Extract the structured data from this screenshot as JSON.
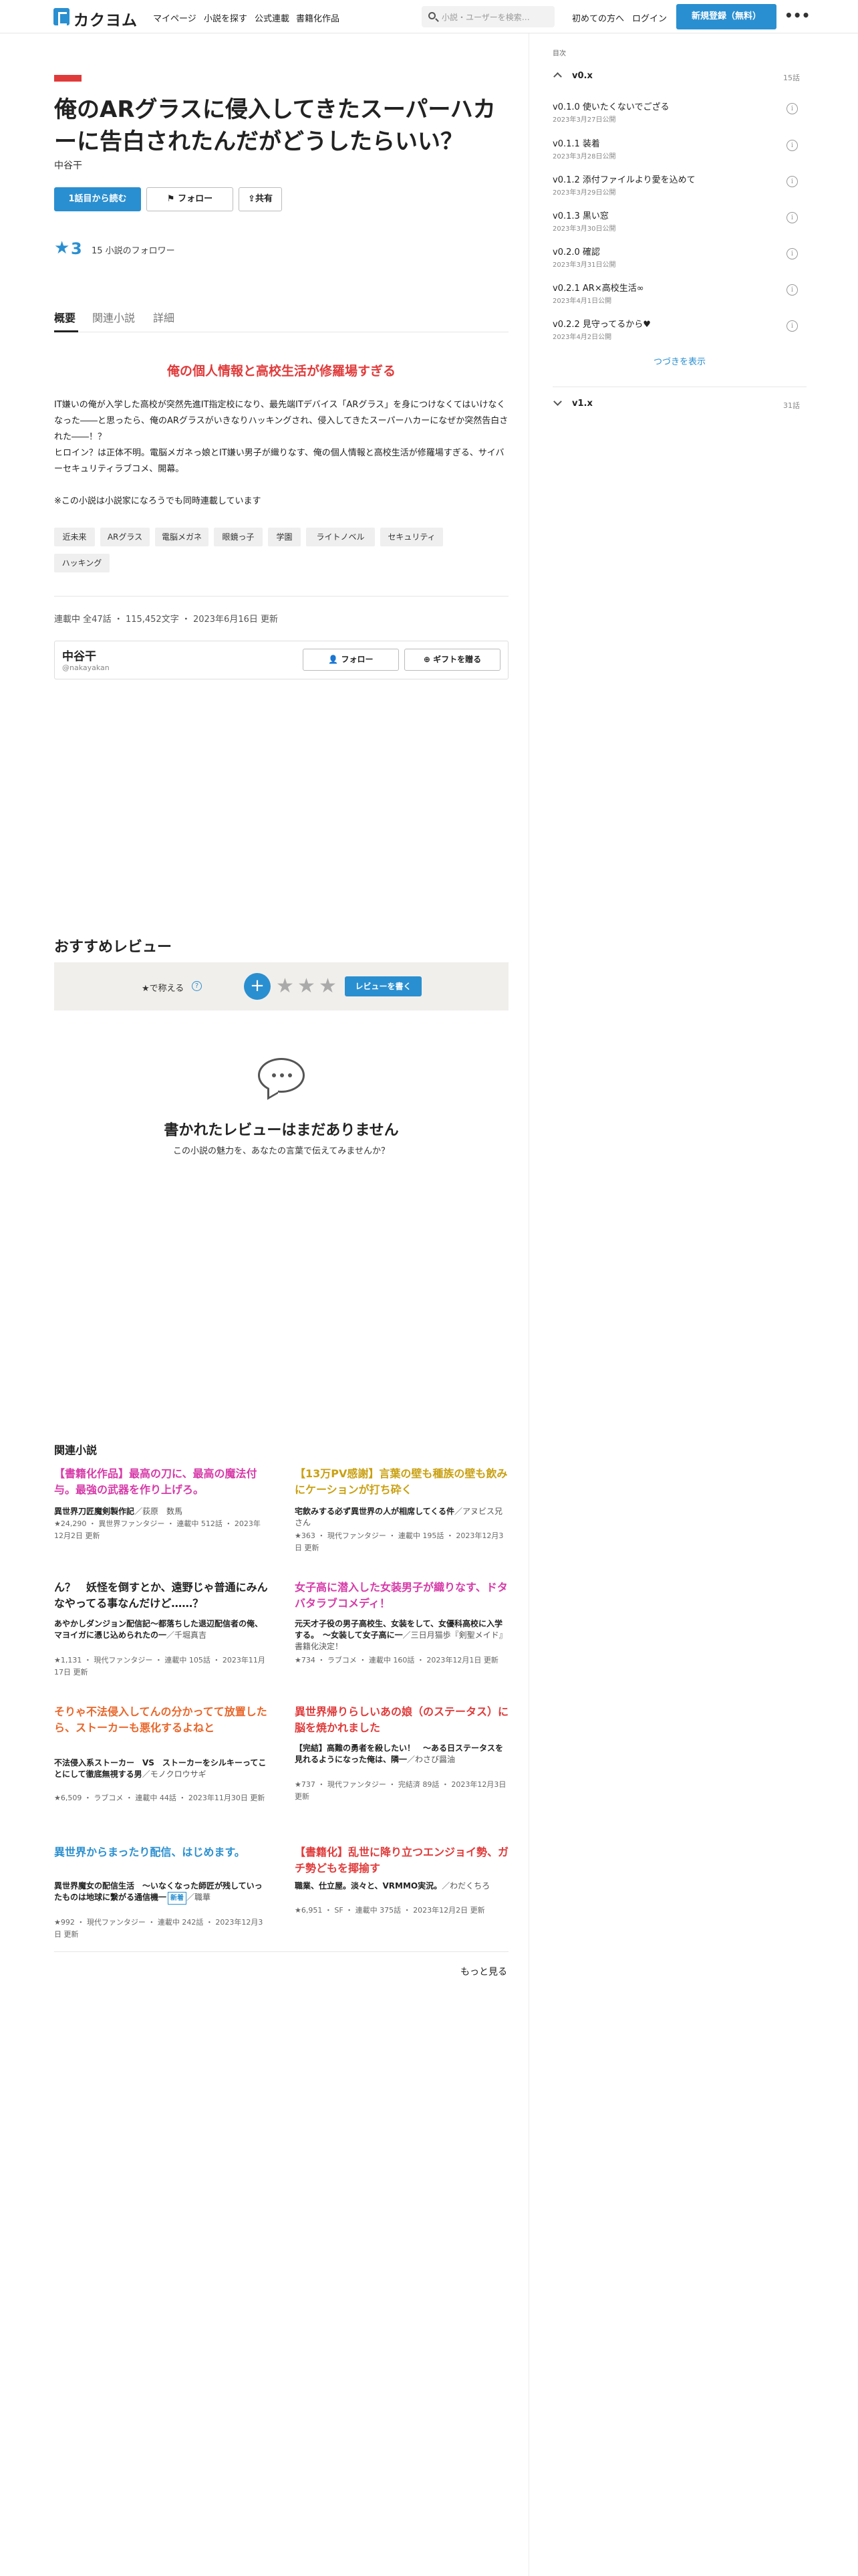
{
  "header": {
    "logo": "カクヨム",
    "nav": [
      "マイページ",
      "小説を探す",
      "公式連載",
      "書籍化作品"
    ],
    "search_placeholder": "小説・ユーザーを検索…",
    "first_time": "初めての方へ",
    "login": "ログイン",
    "register": "新規登録（無料）",
    "more": "•••"
  },
  "work": {
    "title": "俺のARグラスに侵入してきたスーパーハカーに告白されたんだがどうしたらいい？",
    "author": "中谷干",
    "read_button": "1話目から読む",
    "follow_button": "フォロー",
    "share_button": "共有",
    "stars": "3",
    "followers": "15 小説のフォロワー",
    "tabs": [
      "概要",
      "関連小説",
      "詳細"
    ],
    "catchphrase": "俺の個人情報と高校生活が修羅場すぎる",
    "introduction": "IT嫌いの俺が入学した高校が突然先進IT指定校になり、最先端ITデバイス「ARグラス」を身につけなくてはいけなくなった――と思ったら、俺のARグラスがいきなりハッキングされ、侵入してきたスーパーハカーになぜか突然告白された――！？\nヒロイン？は正体不明。電脳メガネっ娘とIT嫌い男子が織りなす、俺の個人情報と高校生活が修羅場すぎる、サイバーセキュリティラブコメ、開幕。\n\n※この小説は小説家になろうでも同時連載しています",
    "tags": [
      "近未来",
      "ARグラス",
      "電脳メガネ",
      "眼鏡っ子",
      "学園",
      "ライトノベル",
      "セキュリティ",
      "ハッキング"
    ],
    "meta": "連載中 全47話 ・ 115,452文字 ・ 2023年6月16日 更新"
  },
  "author_card": {
    "name": "中谷干",
    "id": "@nakayakan",
    "follow": "フォロー",
    "gift": "ギフトを贈る"
  },
  "reviews": {
    "heading": "おすすめレビュー",
    "star_label": "★で称える",
    "help": "?",
    "plus": "+",
    "write_button": "レビューを書く",
    "empty_title": "書かれたレビューはまだありません",
    "empty_sub": "この小説の魅力を、あなたの言葉で伝えてみませんか？"
  },
  "related": {
    "heading": "関連小説",
    "more": "もっと見る",
    "items": [
      {
        "title": "【書籍化作品】最高の刀に、最高の魔法付与。最強の武器を作り上げろ。",
        "catch": "異世界刀匠魔剣製作記",
        "author": "／荻原　数馬",
        "meta": "★24,290 ・ 異世界ファンタジー ・ 連載中 512話 ・ 2023年12月2日 更新",
        "color": "#d63aa8"
      },
      {
        "title": "【13万PV感謝】言葉の壁も種族の壁も飲みにケーションが打ち砕く",
        "catch": "宅飲みする必ず異世界の人が相席してくる件",
        "author": "／アヌビス兄さん",
        "meta": "★363 ・ 現代ファンタジー ・ 連載中 195話 ・ 2023年12月3日 更新",
        "color": "#c9a012"
      },
      {
        "title": "ん？　妖怪を倒すとか、遠野じゃ普通にみんなやってる事なんだけど……？",
        "catch": "あやかしダンジョン配信記〜都落ちした退辺配信者の俺、マヨイガに憑じ込められたの一",
        "author": "／千堀真吉",
        "meta": "★1,131 ・ 現代ファンタジー ・ 連載中 105話 ・ 2023年11月17日 更新",
        "color": "#222222"
      },
      {
        "title": "女子高に潜入した女装男子が織りなす、ドタバタラブコメディ！",
        "catch": "元天才子役の男子高校生、女装をして、女優科高校に入学する。　〜女装して女子高に一",
        "author": "／三日月猫歩『剣聖メイド』書籍化決定！",
        "meta": "★734 ・ ラブコメ ・ 連載中 160話 ・ 2023年12月1日 更新",
        "color": "#d63aa8"
      },
      {
        "title": "そりゃ不法侵入してんの分かってて放置したら、ストーカーも悪化するよねと",
        "catch": "不法侵入系ストーカー　VS　ストーカーをシルキーってことにして徹底無視する男",
        "author": "／モノクロウサギ",
        "meta": "★6,509 ・ ラブコメ ・ 連載中 44話 ・ 2023年11月30日 更新",
        "color": "#e8662a"
      },
      {
        "title": "異世界帰りらしいあの娘（のステータス）に脳を焼かれました",
        "catch": "【完結】高難の勇者を殺したい！　〜ある日ステータスを見れるようになった俺は、隣一",
        "author": "／わさび醤油",
        "meta": "★737 ・ 現代ファンタジー ・ 完結済 89話 ・ 2023年12月3日 更新",
        "color": "#e03a3a"
      },
      {
        "title": "異世界からまったり配信、はじめます。",
        "catch": "異世界魔女の配信生活　〜いなくなった師匠が残していったものは地球に繋がる通信機一",
        "author": "／職華",
        "meta": "★992 ・ 現代ファンタジー ・ 連載中 242話 ・ 2023年12月3日 更新",
        "color": "#2a8fd0"
      },
      {
        "title": "【書籍化】乱世に降り立つエンジョイ勢、ガチ勢どもを揶揄す",
        "catch": "職業、仕立屋。淡々と、VRMMO実況。",
        "author": "／わだくちろ",
        "meta": "★6,951 ・ SF ・ 連載中 375話 ・ 2023年12月2日 更新",
        "color": "#e03a3a"
      }
    ],
    "new_badge": "新着"
  },
  "toc": {
    "label": "目次",
    "volumes": [
      {
        "title": "v0.x",
        "count": "15話"
      },
      {
        "title": "v1.x",
        "count": "31話"
      }
    ],
    "episodes": [
      {
        "title": "v0.1.0 使いたくないでござる",
        "date": "2023年3月27日公開"
      },
      {
        "title": "v0.1.1 装着",
        "date": "2023年3月28日公開"
      },
      {
        "title": "v0.1.2 添付ファイルより愛を込めて",
        "date": "2023年3月29日公開"
      },
      {
        "title": "v0.1.3 黒い窓",
        "date": "2023年3月30日公開"
      },
      {
        "title": "v0.2.0 確認",
        "date": "2023年3月31日公開"
      },
      {
        "title": "v0.2.1 AR×高校生活∞",
        "date": "2023年4月1日公開"
      },
      {
        "title": "v0.2.2 見守ってるから♥",
        "date": "2023年4月2日公開"
      }
    ],
    "next": "つづきを表示"
  },
  "colors": {
    "accent": "#2a8fd0",
    "catch_red": "#e03a3a"
  }
}
